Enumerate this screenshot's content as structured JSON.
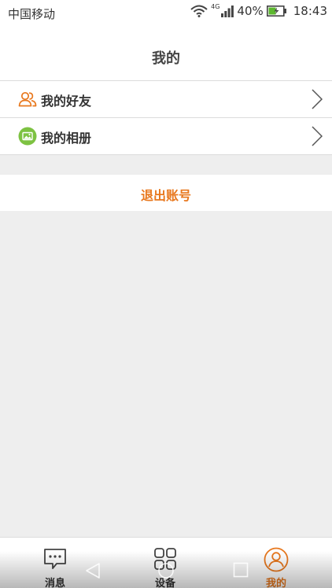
{
  "status_bar": {
    "carrier": "中国移动",
    "network": "4G",
    "battery_percent": "40%",
    "time": "18:43"
  },
  "header": {
    "title": "我的"
  },
  "menu": {
    "items": [
      {
        "label": "我的好友",
        "icon": "friends-icon"
      },
      {
        "label": "我的相册",
        "icon": "photo-album-icon"
      }
    ]
  },
  "logout": {
    "label": "退出账号"
  },
  "tabs": [
    {
      "label": "消息",
      "icon": "message-icon",
      "active": false
    },
    {
      "label": "设备",
      "icon": "device-grid-icon",
      "active": false
    },
    {
      "label": "我的",
      "icon": "profile-icon",
      "active": true
    }
  ],
  "colors": {
    "accent": "#e8781e",
    "album_icon_green": "#7dc242",
    "background": "#eeeeee"
  }
}
